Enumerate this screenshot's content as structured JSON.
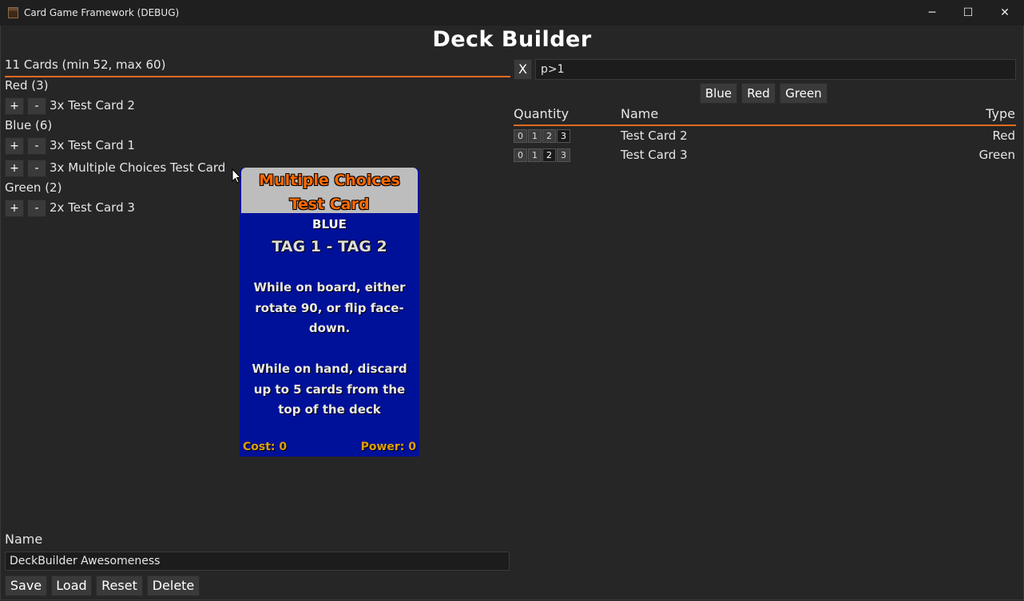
{
  "window": {
    "title": "Card Game Framework (DEBUG)",
    "min_icon": "─",
    "max_icon": "☐",
    "close_icon": "✕"
  },
  "heading": "Deck Builder",
  "deck": {
    "summary": "11 Cards (min 52, max 60)",
    "plus": "+",
    "minus": "-",
    "categories": [
      {
        "label": "Red (3)",
        "cards": [
          "3x Test Card 2"
        ]
      },
      {
        "label": "Blue (6)",
        "cards": [
          "3x Test Card 1",
          "3x Multiple Choices Test Card"
        ]
      },
      {
        "label": "Green (2)",
        "cards": [
          "2x Test Card 3"
        ]
      }
    ]
  },
  "preview": {
    "title": "Multiple Choices Test Card",
    "type": "BLUE",
    "tags": "TAG 1 - TAG 2",
    "text": "While on board, either rotate 90, or flip face-down.\n\nWhile on hand, discard up to 5 cards from the top of the deck",
    "cost": "Cost: 0",
    "power": "Power: 0",
    "colors": {
      "body": "#001199",
      "header": "#bdbdbd",
      "title": "#ff6a00"
    }
  },
  "search": {
    "clear_label": "X",
    "value": "p>1",
    "filters": [
      "Blue",
      "Red",
      "Green"
    ]
  },
  "table": {
    "headers": {
      "quantity": "Quantity",
      "name": "Name",
      "type": "Type"
    },
    "qty_options": [
      "0",
      "1",
      "2",
      "3"
    ],
    "rows": [
      {
        "name": "Test Card 2",
        "type": "Red",
        "selected_qty": 3
      },
      {
        "name": "Test Card 3",
        "type": "Green",
        "selected_qty": 2
      }
    ]
  },
  "deck_name": {
    "label": "Name",
    "value": "DeckBuilder Awesomeness"
  },
  "actions": [
    "Save",
    "Load",
    "Reset",
    "Delete"
  ],
  "colors": {
    "accent": "#e06a1e",
    "background": "#262626"
  }
}
